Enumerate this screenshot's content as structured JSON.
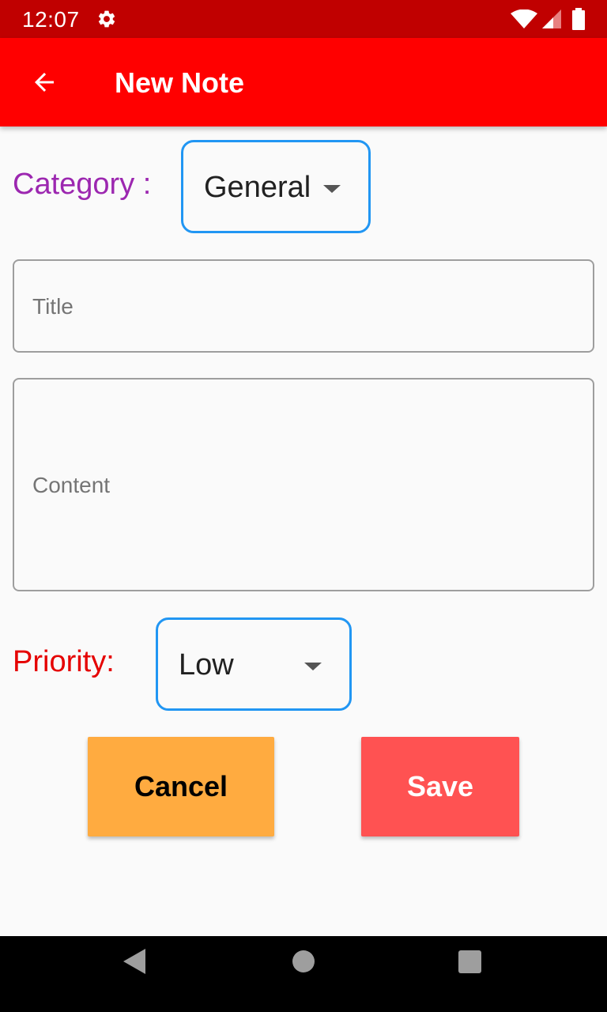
{
  "status_bar": {
    "time": "12:07",
    "icons": [
      "gear-icon",
      "wifi-icon",
      "signal-icon",
      "battery-icon"
    ]
  },
  "app_bar": {
    "title": "New Note",
    "back_icon": "arrow-back-icon"
  },
  "form": {
    "category_label": "Category :",
    "category_value": "General",
    "title_placeholder": "Title",
    "content_placeholder": "Content",
    "priority_label": "Priority:",
    "priority_value": "Low"
  },
  "buttons": {
    "cancel_label": "Cancel",
    "save_label": "Save"
  },
  "nav_bar": {
    "icons": [
      "nav-back-icon",
      "nav-home-icon",
      "nav-recents-icon"
    ]
  },
  "colors": {
    "status_bar": "#c00000",
    "app_bar": "#ff0000",
    "category_label": "#9c27b0",
    "priority_label": "#e50000",
    "dropdown_border": "#2196f3",
    "cancel_button": "#ffab40",
    "save_button": "#ff5252"
  }
}
